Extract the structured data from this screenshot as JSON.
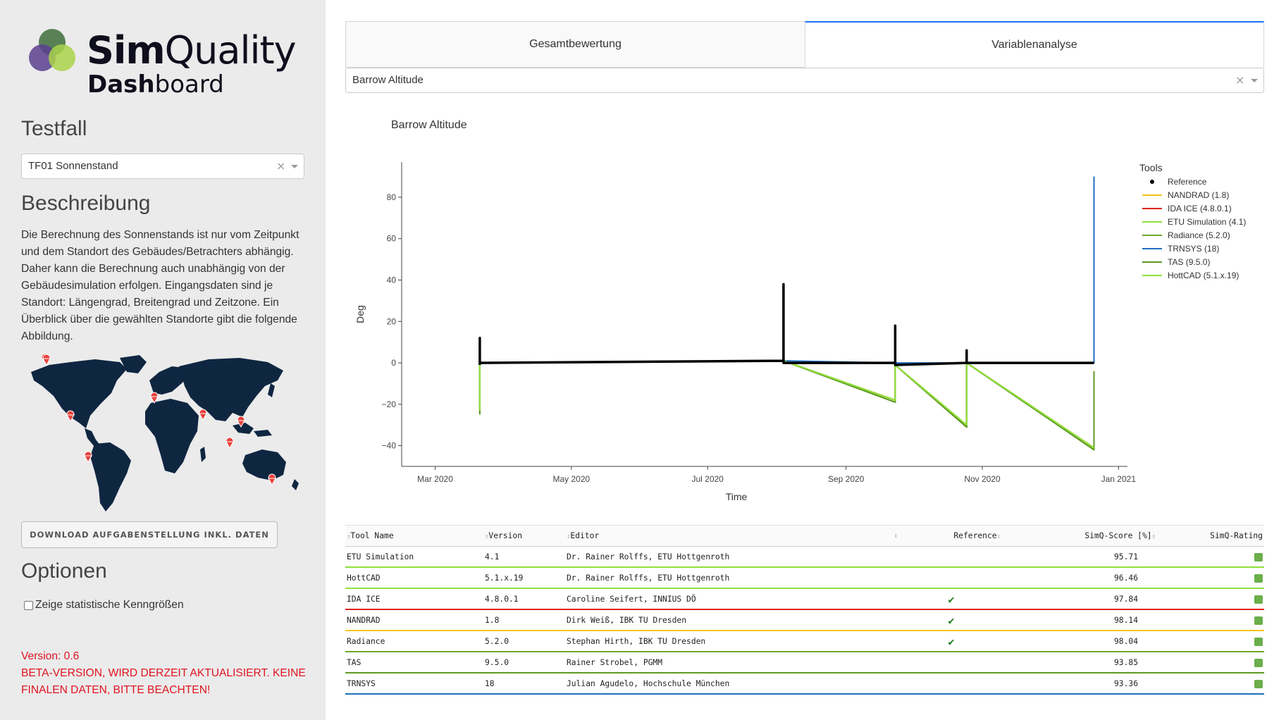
{
  "app": {
    "logo_word_bold": "Sim",
    "logo_word_rest": "Quality",
    "logo_sub_bold": "Dash",
    "logo_sub_rest": "board"
  },
  "sidebar": {
    "testfall_heading": "Testfall",
    "testfall_value": "TF01 Sonnenstand",
    "beschreibung_heading": "Beschreibung",
    "description": "Die Berechnung des Sonnenstands ist nur vom Zeitpunkt und dem Standort des Gebäudes/Betrachters abhängig. Daher kann die Berechnung auch unabhängig von der Gebäudesimulation erfolgen. Eingangsdaten sind je Standort: Längengrad, Breitengrad und Zeitzone. Ein Überblick über die gewählten Standorte gibt die folgende Abbildung.",
    "download_label": "DOWNLOAD AUFGABENSTELLUNG INKL. DATEN",
    "optionen_heading": "Optionen",
    "stats_label": "Zeige statistische Kenngrößen",
    "version_line": "Version: 0.6",
    "beta_line": "BETA-VERSION, WIRD DERZEIT AKTUALISIERT. KEINE FINALEN DATEN, BITTE BEACHTEN!"
  },
  "tabs": [
    {
      "label": "Gesamtbewertung"
    },
    {
      "label": "Variablenanalyse"
    }
  ],
  "variable_select": {
    "value": "Barrow Altitude"
  },
  "colors": {
    "sidebar_bg": "#ebebeb",
    "tab_active_border": "#1975fa",
    "version_red": "#e0131f",
    "map_dark": "#0f2641",
    "marker": "#e8413c",
    "rating_green": "#6bae4a"
  },
  "chart_data": {
    "type": "line",
    "title": "Barrow Altitude",
    "xlabel": "Time",
    "ylabel": "Deg",
    "x_ticks": [
      "Mar 2020",
      "May 2020",
      "Jul 2020",
      "Sep 2020",
      "Nov 2020",
      "Jan 2021"
    ],
    "y_ticks": [
      80,
      60,
      40,
      20,
      0,
      -20,
      -40
    ],
    "ylim": [
      -50,
      97
    ],
    "legend_title": "Tools",
    "legend_position": "right",
    "x_domain": [
      "2020-02-15",
      "2021-01-05"
    ],
    "series": [
      {
        "name": "Reference",
        "color": "#000000",
        "marker": true,
        "points": [
          [
            "2020-03-21",
            -1
          ],
          [
            "2020-03-21",
            12
          ],
          [
            "2020-03-21",
            0
          ],
          [
            "2020-08-04",
            1
          ],
          [
            "2020-08-04",
            38
          ],
          [
            "2020-08-04",
            0
          ],
          [
            "2020-09-23",
            0
          ],
          [
            "2020-09-23",
            18
          ],
          [
            "2020-09-23",
            -1
          ],
          [
            "2020-10-25",
            0
          ],
          [
            "2020-10-25",
            6
          ],
          [
            "2020-10-25",
            0
          ],
          [
            "2020-12-21",
            0
          ]
        ]
      },
      {
        "name": "NANDRAD (1.8)",
        "color": "#f5c518",
        "points": [
          [
            "2020-03-21",
            -23
          ],
          [
            "2020-03-21",
            12
          ],
          [
            "2020-03-21",
            0
          ],
          [
            "2020-08-04",
            1
          ],
          [
            "2020-08-04",
            38
          ],
          [
            "2020-08-04",
            1
          ],
          [
            "2020-09-23",
            -18
          ],
          [
            "2020-09-23",
            18
          ],
          [
            "2020-09-23",
            -1
          ],
          [
            "2020-10-25",
            -30
          ],
          [
            "2020-10-25",
            6
          ],
          [
            "2020-10-25",
            0
          ],
          [
            "2020-12-21",
            -41
          ]
        ]
      },
      {
        "name": "IDA ICE (4.8.0.1)",
        "color": "#e3211c",
        "points": [
          [
            "2020-03-21",
            -24
          ],
          [
            "2020-03-21",
            12
          ],
          [
            "2020-03-21",
            0
          ],
          [
            "2020-08-04",
            1
          ],
          [
            "2020-08-04",
            38
          ],
          [
            "2020-08-04",
            1
          ],
          [
            "2020-09-23",
            -18
          ],
          [
            "2020-09-23",
            18
          ],
          [
            "2020-09-23",
            -1
          ],
          [
            "2020-10-25",
            -31
          ],
          [
            "2020-10-25",
            6
          ],
          [
            "2020-10-25",
            0
          ],
          [
            "2020-12-21",
            -41
          ]
        ]
      },
      {
        "name": "ETU Simulation (4.1)",
        "color": "#8fe03c",
        "points": [
          [
            "2020-03-21",
            -23
          ],
          [
            "2020-03-21",
            12
          ],
          [
            "2020-03-21",
            0
          ],
          [
            "2020-08-04",
            1
          ],
          [
            "2020-08-04",
            38
          ],
          [
            "2020-08-04",
            1
          ],
          [
            "2020-09-23",
            -18
          ],
          [
            "2020-09-23",
            18
          ],
          [
            "2020-09-23",
            -1
          ],
          [
            "2020-10-25",
            -30
          ],
          [
            "2020-10-25",
            6
          ],
          [
            "2020-10-25",
            0
          ],
          [
            "2020-12-21",
            -41
          ]
        ]
      },
      {
        "name": "Radiance (5.2.0)",
        "color": "#6fa72a",
        "points": [
          [
            "2020-03-21",
            -24
          ],
          [
            "2020-03-21",
            12
          ],
          [
            "2020-03-21",
            0
          ],
          [
            "2020-08-04",
            1
          ],
          [
            "2020-08-04",
            38
          ],
          [
            "2020-08-04",
            1
          ],
          [
            "2020-09-23",
            -19
          ],
          [
            "2020-09-23",
            18
          ],
          [
            "2020-09-23",
            -1
          ],
          [
            "2020-10-25",
            -31
          ],
          [
            "2020-10-25",
            6
          ],
          [
            "2020-10-25",
            0
          ],
          [
            "2020-12-21",
            -42
          ]
        ]
      },
      {
        "name": "TRNSYS (18)",
        "color": "#1f6fbf",
        "points": [
          [
            "2020-03-21",
            0
          ],
          [
            "2020-08-04",
            1
          ],
          [
            "2020-09-23",
            0
          ],
          [
            "2020-12-21",
            0
          ],
          [
            "2020-12-21",
            90
          ]
        ]
      },
      {
        "name": "TAS (9.5.0)",
        "color": "#5f9a24",
        "points": [
          [
            "2020-03-21",
            -25
          ],
          [
            "2020-03-21",
            12
          ],
          [
            "2020-03-21",
            0
          ],
          [
            "2020-08-04",
            1
          ],
          [
            "2020-08-04",
            38
          ],
          [
            "2020-08-04",
            1
          ],
          [
            "2020-09-23",
            -19
          ],
          [
            "2020-09-23",
            18
          ],
          [
            "2020-09-23",
            -1
          ],
          [
            "2020-10-25",
            -31
          ],
          [
            "2020-10-25",
            6
          ],
          [
            "2020-10-25",
            0
          ],
          [
            "2020-12-21",
            -42
          ],
          [
            "2020-12-21",
            -4
          ]
        ]
      },
      {
        "name": "HottCAD (5.1.x.19)",
        "color": "#8fe03c",
        "points": [
          [
            "2020-03-21",
            -23
          ],
          [
            "2020-03-21",
            12
          ],
          [
            "2020-03-21",
            0
          ],
          [
            "2020-08-04",
            1
          ],
          [
            "2020-08-04",
            38
          ],
          [
            "2020-08-04",
            1
          ],
          [
            "2020-09-23",
            -18
          ],
          [
            "2020-09-23",
            18
          ],
          [
            "2020-09-23",
            -1
          ],
          [
            "2020-10-25",
            -30
          ],
          [
            "2020-10-25",
            6
          ],
          [
            "2020-10-25",
            0
          ],
          [
            "2020-12-21",
            -41
          ]
        ]
      }
    ]
  },
  "table": {
    "headers": [
      "Tool Name",
      "Version",
      "Editor",
      "Reference",
      "SimQ-Score [%]",
      "SimQ-Rating"
    ],
    "rows": [
      {
        "tool": "ETU Simulation",
        "version": "4.1",
        "editor": "Dr. Rainer Rolffs, ETU Hottgenroth",
        "reference": false,
        "score": "95.71",
        "line_color": "#8fe03c"
      },
      {
        "tool": "HottCAD",
        "version": "5.1.x.19",
        "editor": "Dr. Rainer Rolffs, ETU Hottgenroth",
        "reference": false,
        "score": "96.46",
        "line_color": "#8fe03c"
      },
      {
        "tool": "IDA ICE",
        "version": "4.8.0.1",
        "editor": "Caroline Seifert, INNIUS DÖ",
        "reference": true,
        "score": "97.84",
        "line_color": "#e3211c"
      },
      {
        "tool": "NANDRAD",
        "version": "1.8",
        "editor": "Dirk Weiß, IBK TU Dresden",
        "reference": true,
        "score": "98.14",
        "line_color": "#f5c518"
      },
      {
        "tool": "Radiance",
        "version": "5.2.0",
        "editor": "Stephan Hirth, IBK TU Dresden",
        "reference": true,
        "score": "98.04",
        "line_color": "#6fa72a"
      },
      {
        "tool": "TAS",
        "version": "9.5.0",
        "editor": "Rainer Strobel, PGMM",
        "reference": false,
        "score": "93.85",
        "line_color": "#5f9a24"
      },
      {
        "tool": "TRNSYS",
        "version": "18",
        "editor": "Julian Agudelo, Hochschule München",
        "reference": false,
        "score": "93.36",
        "line_color": "#1f6fbf"
      }
    ]
  }
}
